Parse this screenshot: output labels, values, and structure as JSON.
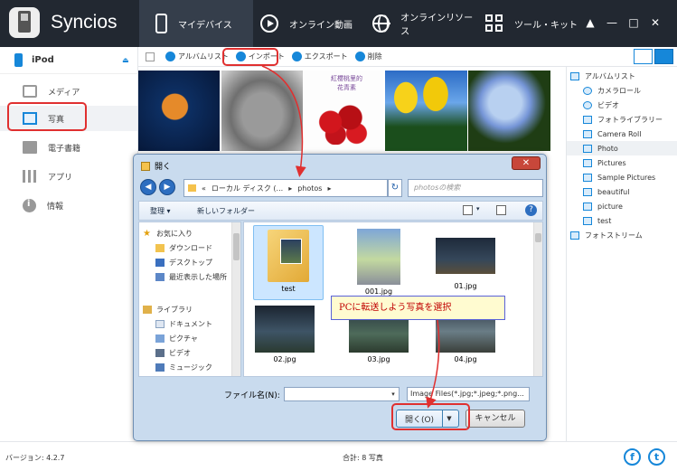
{
  "app": {
    "brand": "Syncios",
    "nav_tabs": [
      "マイデバイス",
      "オンライン動画",
      "オンラインリソース",
      "ツール・キット"
    ],
    "window_controls": [
      "▲",
      "—",
      "□",
      "✕"
    ]
  },
  "sidebar": {
    "device": "iPod",
    "items": [
      "メディア",
      "写真",
      "電子書籍",
      "アプリ",
      "情報"
    ]
  },
  "toolbar": {
    "album_list": "アルバムリスト",
    "import": "インポート",
    "export": "エクスポート",
    "delete": "削除"
  },
  "photo_strip": {
    "card_lines": [
      "紅櫻桃里的",
      "花青素"
    ]
  },
  "right_panel": {
    "items": [
      "アルバムリスト",
      "カメラロール",
      "ビデオ",
      "フォトライブラリー",
      "Camera Roll",
      "Photo",
      "Pictures",
      "Sample Pictures",
      "beautiful",
      "picture",
      "test",
      "フォトストリーム"
    ],
    "selected": "Photo"
  },
  "status": {
    "version": "バージョン: 4.2.7",
    "total": "合計: 8 写真"
  },
  "dialog": {
    "title": "開く",
    "close": "✕",
    "breadcrumb_prefix": "«",
    "breadcrumb": [
      "ローカル ディスク (...",
      "photos"
    ],
    "search_placeholder": "photosの検索",
    "organize": "整理 ▾",
    "new_folder": "新しいフォルダー",
    "tree": [
      {
        "label": "お気に入り",
        "type": "group"
      },
      {
        "label": "ダウンロード",
        "type": "folder"
      },
      {
        "label": "デスクトップ",
        "type": "desktop"
      },
      {
        "label": "最近表示した場所",
        "type": "recent"
      },
      {
        "label": "ライブラリ",
        "type": "group"
      },
      {
        "label": "ドキュメント",
        "type": "doc"
      },
      {
        "label": "ピクチャ",
        "type": "pic"
      },
      {
        "label": "ビデオ",
        "type": "video"
      },
      {
        "label": "ミュージック",
        "type": "music"
      }
    ],
    "files": [
      "test",
      "001.jpg",
      "01.jpg",
      "02.jpg",
      "03.jpg",
      "04.jpg"
    ],
    "filename_label": "ファイル名(N):",
    "filename_value": "",
    "filetype": "Image Files(*.jpg;*.jpeg;*.png...",
    "open_button": "開く(O)",
    "cancel_button": "キャンセル"
  },
  "callout": "PCに転送しよう写真を選択",
  "colors": {
    "accent": "#1687d9",
    "highlight": "#e03030",
    "topbar": "#222831"
  }
}
